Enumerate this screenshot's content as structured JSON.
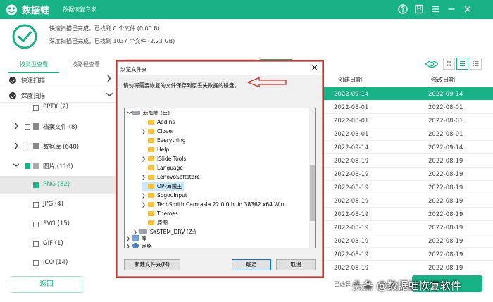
{
  "app": {
    "name": "数据蛙",
    "slogan": "数据恢复专家"
  },
  "summary": {
    "quick_scan": "快速扫描已完成，已找到 0 个文件 (0.00  B)",
    "deep_scan": "深度扫描已完成，已找到 1037 个文件 (2.23 GB)"
  },
  "tabs": [
    {
      "label": "按类型查看"
    },
    {
      "label": "按路径查看"
    }
  ],
  "sidebar": {
    "sections": [
      {
        "label": "快速扫描"
      },
      {
        "label": "深度扫描"
      }
    ],
    "tree": [
      {
        "label": "PPTX (2)"
      },
      {
        "label": "档案文件 (8)"
      },
      {
        "label": "数据库 (640)"
      },
      {
        "label": "图片 (116)"
      },
      {
        "label": "PNG (82)"
      },
      {
        "label": "JPG (4)"
      },
      {
        "label": "SVG (15)"
      },
      {
        "label": "GIF (1)"
      },
      {
        "label": "ICO (14)"
      }
    ]
  },
  "table": {
    "headers": {
      "created": "创建日期",
      "modified": "修改日期"
    },
    "rows": [
      {
        "created": "2022-09-14",
        "modified": "2022-09-14"
      },
      {
        "created": "2022-08-01",
        "modified": "2022-08-01"
      },
      {
        "created": "2022-08-01",
        "modified": "2022-08-01"
      },
      {
        "created": "2022-08-01",
        "modified": "2022-08-01"
      },
      {
        "created": "2022-09-14",
        "modified": "2022-09-14"
      },
      {
        "created": "2022-08-19",
        "modified": "2022-08-19"
      },
      {
        "created": "2022-08-19",
        "modified": "2022-08-19"
      },
      {
        "created": "2022-08-19",
        "modified": "2022-08-19"
      },
      {
        "created": "2022-08-19",
        "modified": "2022-08-19"
      },
      {
        "created": "2022-08-19",
        "modified": "2022-08-19"
      },
      {
        "created": "2022-08-19",
        "modified": "2022-08-19"
      },
      {
        "created": "2022-08-19",
        "modified": "2022-08-19"
      },
      {
        "created": "2022-08-19",
        "modified": "2022-08-19"
      },
      {
        "created": "2022-08-19",
        "modified": "2022-08-19"
      }
    ]
  },
  "footer": {
    "back_label": "返回",
    "selected_info": "已选择",
    "watermark": "头条 @数据蛙恢复软件"
  },
  "dialog": {
    "title": "浏览文件夹",
    "close": "✕",
    "instruction": "请勿将需要恢复的文件保存到原丢失数据的磁盘。",
    "tree": [
      {
        "label": "新加卷 (E:)"
      },
      {
        "label": "Addins"
      },
      {
        "label": "Clover"
      },
      {
        "label": "Everything"
      },
      {
        "label": "Help"
      },
      {
        "label": "iSlide Tools"
      },
      {
        "label": "Language"
      },
      {
        "label": "LenovoSoftstore"
      },
      {
        "label": "OP-海贼王"
      },
      {
        "label": "SogouInput"
      },
      {
        "label": "TechSmith Camtasia 22.0.0 buid 38362 x64 Win"
      },
      {
        "label": "Themes"
      },
      {
        "label": "原图"
      },
      {
        "label": "SYSTEM_DRV (Z:)"
      },
      {
        "label": "库"
      },
      {
        "label": "网络"
      }
    ],
    "new_folder": "新建文件夹(M)",
    "ok": "确定",
    "cancel": "取消"
  },
  "colors": {
    "brand": "#19b287",
    "highlight": "#d4302b",
    "selection": "#cce8ff"
  }
}
